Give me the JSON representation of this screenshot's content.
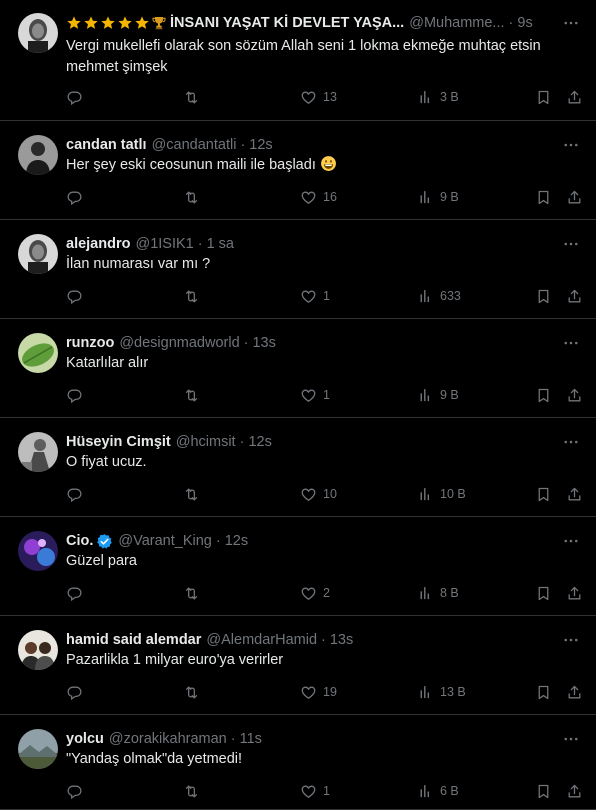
{
  "tweets": [
    {
      "name": "İNSANI YAŞAT Kİ DEVLET YAŞA...",
      "name_prefix_icons": [
        "star-icon",
        "star-icon",
        "star-icon",
        "star-icon",
        "star-icon",
        "trophy-icon"
      ],
      "handle": "@Muhamme...",
      "time": "9s",
      "text": "Vergi mukellefi olarak son sözüm Allah seni 1 lokma ekmeğe muhtaç etsin mehmet şimşek",
      "likes": "13",
      "views": "3 B",
      "avatar": "avatar-portrait-bw"
    },
    {
      "name": "candan tatlı",
      "handle": "@candantatli",
      "time": "12s",
      "text": "Her şey eski ceosunun maili ile başladı",
      "text_emoji": "grinning-face-icon",
      "likes": "16",
      "views": "9 B",
      "avatar": "avatar-person-dark"
    },
    {
      "name": "alejandro",
      "handle": "@1ISIK1",
      "time": "1 sa",
      "text": "İlan numarası var mı ?",
      "likes": "1",
      "views": "633",
      "avatar": "avatar-portrait-bw"
    },
    {
      "name": "runzoo",
      "handle": "@designmadworld",
      "time": "13s",
      "text": "Katarlılar alır",
      "likes": "1",
      "views": "9 B",
      "avatar": "avatar-green-leaf"
    },
    {
      "name": "Hüseyin Cimşit",
      "handle": "@hcimsit",
      "time": "12s",
      "text": "O fiyat ucuz.",
      "likes": "10",
      "views": "10 B",
      "avatar": "avatar-grey-figure"
    },
    {
      "name": "Cio.",
      "verified": true,
      "handle": "@Varant_King",
      "time": "12s",
      "text": "Güzel para",
      "likes": "2",
      "views": "8 B",
      "avatar": "avatar-purple"
    },
    {
      "name": "hamid said alemdar",
      "handle": "@AlemdarHamid",
      "time": "13s",
      "text": "Pazarlikla 1 milyar euro'ya verirler",
      "likes": "19",
      "views": "13 B",
      "avatar": "avatar-two-people"
    },
    {
      "name": "yolcu",
      "handle": "@zorakikahraman",
      "time": "11s",
      "text": "\"Yandaş olmak\"da yetmedi!",
      "likes": "1",
      "views": "6 B",
      "avatar": "avatar-landscape"
    }
  ],
  "colors": {
    "background": "#000000",
    "text": "#e7e9ea",
    "muted": "#71767b",
    "divider": "#2f3336",
    "verified": "#1d9bf0",
    "star": "#f4b400"
  }
}
